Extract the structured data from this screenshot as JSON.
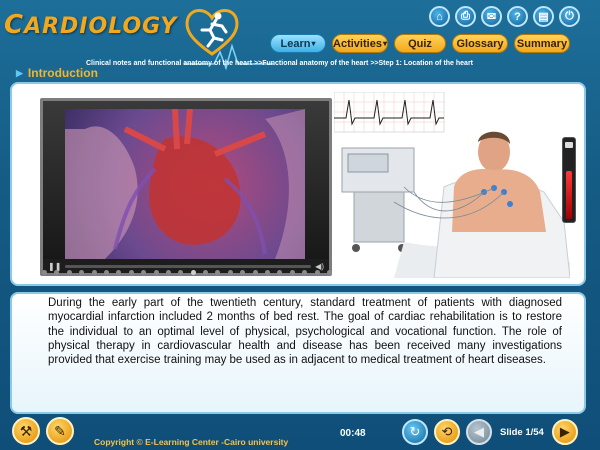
{
  "app": {
    "logo_text_first": "C",
    "logo_text_rest": "ARDIOLOGY"
  },
  "top_icons": [
    {
      "name": "home-icon",
      "glyph": "⌂"
    },
    {
      "name": "print-icon",
      "glyph": "⎙"
    },
    {
      "name": "mail-icon",
      "glyph": "✉"
    },
    {
      "name": "help-icon",
      "glyph": "?"
    },
    {
      "name": "page-icon",
      "glyph": "▤"
    },
    {
      "name": "exit-icon",
      "glyph": "⏻"
    }
  ],
  "nav": {
    "learn": "Learn",
    "activities": "Activities",
    "quiz": "Quiz",
    "glossary": "Glossary",
    "summary": "Summary"
  },
  "breadcrumb": "Clinical notes and functional anatomy of the heart >>Functional anatomy of the heart >>Step 1: Location of the heart",
  "section_title": "Introduction",
  "video": {
    "progress": 0.0
  },
  "body_text": "During the early part of the twentieth century, standard treatment of patients with diagnosed myocardial infarction included 2 months of bed rest. The goal of cardiac rehabilitation is to restore the individual to an optimal level of physical, psychological and vocational function. The role of physical therapy in cardiovascular health and disease has been received many investigations provided that exercise training may be used as in adjacent to medical treatment of heart diseases.",
  "footer": {
    "copyright": "Copyright © E-Learning Center -Cairo university",
    "time": "00:48",
    "slide": "Slide 1/54"
  },
  "colors": {
    "accent_gold": "#f2a81d",
    "accent_blue": "#3fb1e6",
    "background": "#155c85"
  }
}
